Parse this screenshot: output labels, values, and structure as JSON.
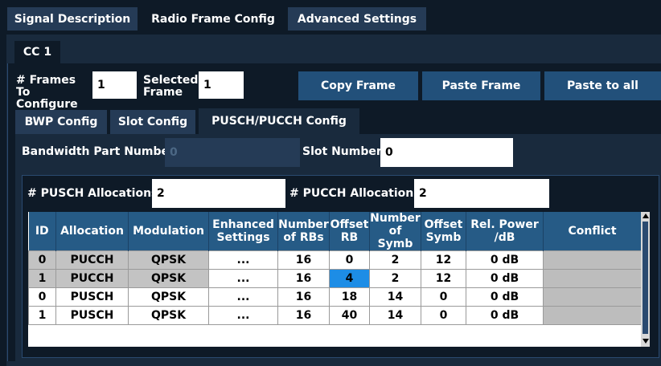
{
  "top_tabs": [
    "Signal Description",
    "Radio Frame Config",
    "Advanced Settings"
  ],
  "cc_tab": "CC 1",
  "frames": {
    "frames_to_configure_label": "# Frames To Configure",
    "frames_to_configure_value": "1",
    "selected_frame_label": "Selected Frame",
    "selected_frame_value": "1",
    "copy_frame": "Copy Frame",
    "paste_frame": "Paste Frame",
    "paste_to_all": "Paste to all"
  },
  "sub_tabs": [
    "BWP Config",
    "Slot Config",
    "PUSCH/PUCCH Config"
  ],
  "bwp": {
    "label": "Bandwidth Part Number",
    "value": "0"
  },
  "slot": {
    "label": "Slot Number",
    "value": "0"
  },
  "pusch_alloc": {
    "label": "# PUSCH Allocations",
    "value": "2"
  },
  "pucch_alloc": {
    "label": "# PUCCH Allocations",
    "value": "2"
  },
  "table": {
    "headers": [
      "ID",
      "Allocation",
      "Modulation",
      "Enhanced Settings",
      "Number of RBs",
      "Offset RB",
      "Number of Symb",
      "Offset Symb",
      "Rel. Power /dB",
      "Conflict"
    ],
    "rows": [
      [
        "0",
        "PUCCH",
        "QPSK",
        "...",
        "16",
        "0",
        "2",
        "12",
        "0 dB",
        ""
      ],
      [
        "1",
        "PUCCH",
        "QPSK",
        "...",
        "16",
        "4",
        "2",
        "12",
        "0 dB",
        ""
      ],
      [
        "0",
        "PUSCH",
        "QPSK",
        "...",
        "16",
        "18",
        "14",
        "0",
        "0 dB",
        ""
      ],
      [
        "1",
        "PUSCH",
        "QPSK",
        "...",
        "16",
        "40",
        "14",
        "0",
        "0 dB",
        ""
      ]
    ]
  },
  "colors": {
    "accent": "#22507a",
    "header": "#265b86",
    "selected_cell": "#1d8de6",
    "background": "#0e1a27"
  }
}
